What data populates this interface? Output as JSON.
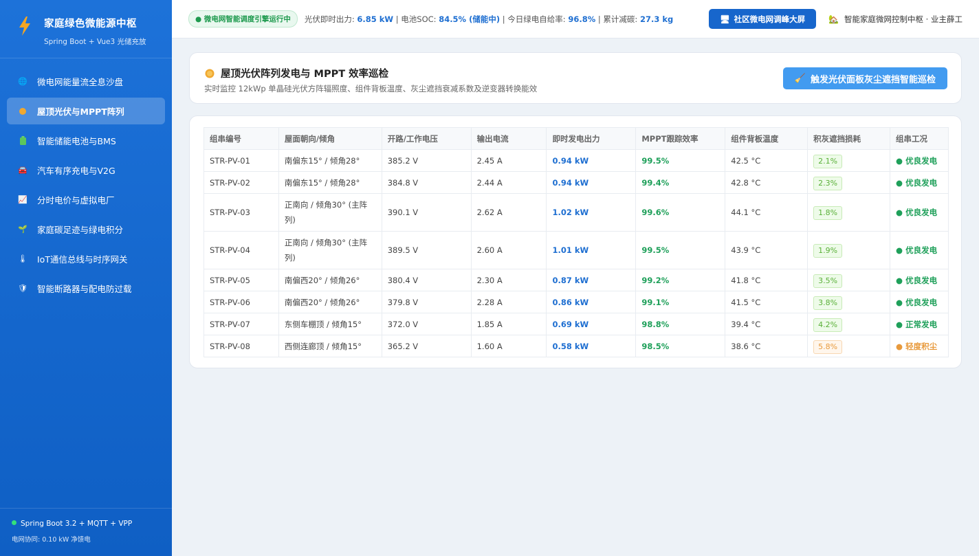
{
  "sidebar": {
    "title": "家庭绿色微能源中枢",
    "subtitle": "Spring Boot + Vue3 光储充放",
    "items": [
      {
        "label": "微电网能量流全息沙盘",
        "icon": "globe-icon",
        "glyph": "🌐",
        "active": false
      },
      {
        "label": "屋顶光伏与MPPT阵列",
        "icon": "sun-icon",
        "glyph": "●",
        "active": true
      },
      {
        "label": "智能储能电池与BMS",
        "icon": "battery-icon",
        "glyph": "▮",
        "active": false
      },
      {
        "label": "汽车有序充电与V2G",
        "icon": "car-icon",
        "glyph": "🚘",
        "active": false
      },
      {
        "label": "分时电价与虚拟电厂",
        "icon": "chart-icon",
        "glyph": "📈",
        "active": false
      },
      {
        "label": "家庭碳足迹与绿电积分",
        "icon": "sprout-icon",
        "glyph": "🌱",
        "active": false
      },
      {
        "label": "IoT通信总线与时序网关",
        "icon": "thermometer-icon",
        "glyph": "🌡",
        "active": false
      },
      {
        "label": "智能断路器与配电防过载",
        "icon": "shield-icon",
        "glyph": "🛡",
        "active": false
      }
    ],
    "footer_line1": "Spring Boot 3.2 + MQTT + VPP",
    "footer_line2": "电网协同: 0.10 kW 净馈电"
  },
  "topbar": {
    "badge": "● 微电网智能调度引擎运行中",
    "pv_label": "光伏即时出力: ",
    "pv_value": "6.85 kW",
    "soc_label": " | 电池SOC: ",
    "soc_value": "84.5% (储能中)",
    "green_label": " | 今日绿电自给率: ",
    "green_value": "96.8%",
    "carbon_label": " | 累计减碳: ",
    "carbon_value": "27.3 kg",
    "screen_button": "社区微电网调峰大屏",
    "user": "智能家庭微网控制中枢 · 业主薛工"
  },
  "header": {
    "title": "屋顶光伏阵列发电与 MPPT 效率巡检",
    "subtitle": "实时监控 12kWp 单晶硅光伏方阵辐照度、组件背板温度、灰尘遮挡衰减系数及逆变器转换能效",
    "patrol_button": "触发光伏面板灰尘遮挡智能巡检"
  },
  "table": {
    "columns": [
      "组串编号",
      "屋面朝向/倾角",
      "开路/工作电压",
      "输出电流",
      "即时发电出力",
      "MPPT跟踪效率",
      "组件背板温度",
      "积灰遮挡损耗",
      "组串工况"
    ],
    "rows": [
      {
        "id": "STR-PV-01",
        "orient": "南偏东15° / 倾角28°",
        "voltage": "385.2 V",
        "current": "2.45 A",
        "power": "0.94 kW",
        "eff": "99.5%",
        "temp": "42.5 °C",
        "loss": "2.1%",
        "status": "● 优良发电",
        "warn": false,
        "tall": false
      },
      {
        "id": "STR-PV-02",
        "orient": "南偏东15° / 倾角28°",
        "voltage": "384.8 V",
        "current": "2.44 A",
        "power": "0.94 kW",
        "eff": "99.4%",
        "temp": "42.8 °C",
        "loss": "2.3%",
        "status": "● 优良发电",
        "warn": false,
        "tall": false
      },
      {
        "id": "STR-PV-03",
        "orient": "正南向 / 倾角30° (主阵列)",
        "voltage": "390.1 V",
        "current": "2.62 A",
        "power": "1.02 kW",
        "eff": "99.6%",
        "temp": "44.1 °C",
        "loss": "1.8%",
        "status": "● 优良发电",
        "warn": false,
        "tall": true
      },
      {
        "id": "STR-PV-04",
        "orient": "正南向 / 倾角30° (主阵列)",
        "voltage": "389.5 V",
        "current": "2.60 A",
        "power": "1.01 kW",
        "eff": "99.5%",
        "temp": "43.9 °C",
        "loss": "1.9%",
        "status": "● 优良发电",
        "warn": false,
        "tall": true
      },
      {
        "id": "STR-PV-05",
        "orient": "南偏西20° / 倾角26°",
        "voltage": "380.4 V",
        "current": "2.30 A",
        "power": "0.87 kW",
        "eff": "99.2%",
        "temp": "41.8 °C",
        "loss": "3.5%",
        "status": "● 优良发电",
        "warn": false,
        "tall": false
      },
      {
        "id": "STR-PV-06",
        "orient": "南偏西20° / 倾角26°",
        "voltage": "379.8 V",
        "current": "2.28 A",
        "power": "0.86 kW",
        "eff": "99.1%",
        "temp": "41.5 °C",
        "loss": "3.8%",
        "status": "● 优良发电",
        "warn": false,
        "tall": false
      },
      {
        "id": "STR-PV-07",
        "orient": "东侧车棚顶 / 倾角15°",
        "voltage": "372.0 V",
        "current": "1.85 A",
        "power": "0.69 kW",
        "eff": "98.8%",
        "temp": "39.4 °C",
        "loss": "4.2%",
        "status": "● 正常发电",
        "warn": false,
        "tall": false
      },
      {
        "id": "STR-PV-08",
        "orient": "西侧连廊顶 / 倾角15°",
        "voltage": "365.2 V",
        "current": "1.60 A",
        "power": "0.58 kW",
        "eff": "98.5%",
        "temp": "38.6 °C",
        "loss": "5.8%",
        "status": "● 轻度积尘",
        "warn": true,
        "tall": false
      }
    ]
  },
  "colors": {
    "sidebar": "#1466cc",
    "accent": "#1f6fd1",
    "success": "#1fa05a",
    "warning": "#e89a3c"
  }
}
